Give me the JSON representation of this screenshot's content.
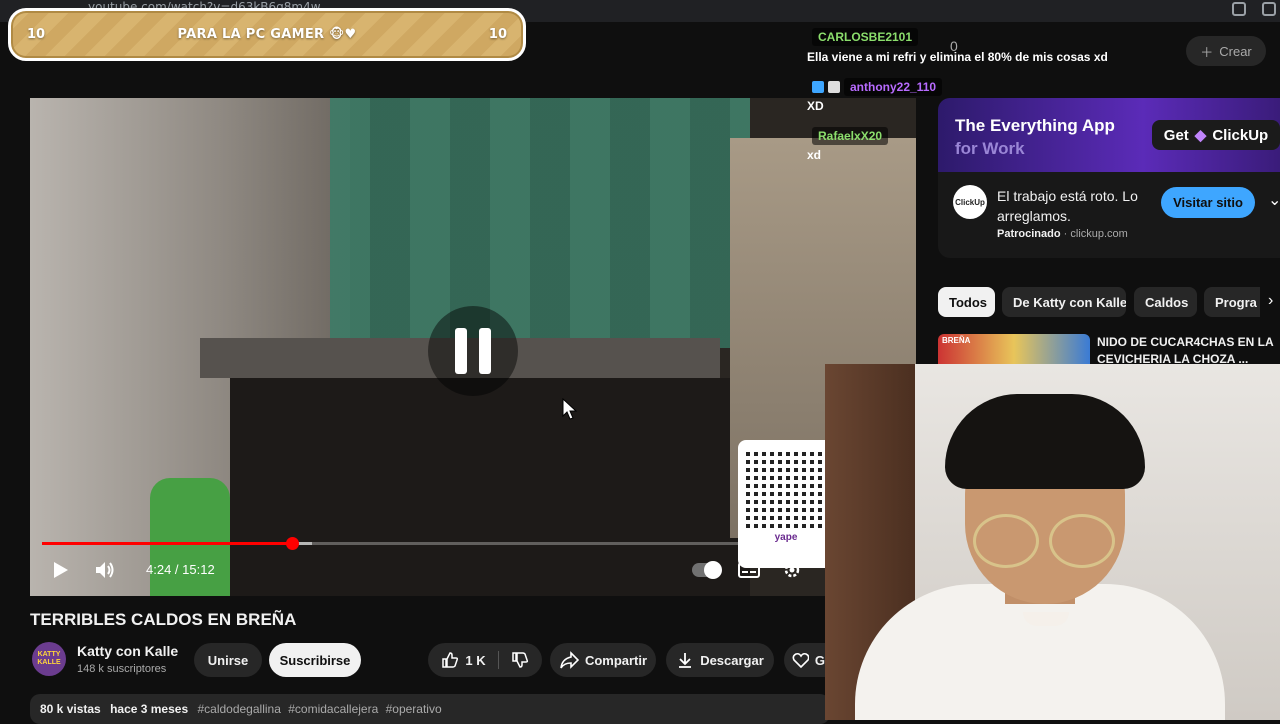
{
  "browser": {
    "url": "youtube.com/watch?v=d63kB6g8m4w"
  },
  "masthead": {
    "bell_count": "0",
    "create_label": "Crear"
  },
  "banner": {
    "left": "10",
    "text": "PARA LA PC GAMER 🐵♥",
    "right": "10"
  },
  "chat": [
    {
      "user": "CARLOSBE2101",
      "user_color": "#8bde6c",
      "message": "Ella viene a mi refri y elimina el 80% de mis cosas xd"
    },
    {
      "user": "anthony22_110",
      "user_color": "#b86bff",
      "message": "XD"
    },
    {
      "user": "RafaelxX20",
      "user_color": "#8bde6c",
      "message": "xd"
    }
  ],
  "player": {
    "time": "4:24 / 15:12",
    "progress": 0.29,
    "qr_label": "yape"
  },
  "video": {
    "title": "TERRIBLES CALDOS EN BREÑA",
    "channel": "Katty con Kalle",
    "avatar_text": "KATTY KALLE",
    "subscribers": "148 k suscriptores",
    "join_label": "Unirse",
    "subscribe_label": "Suscribirse",
    "likes": "1 K",
    "share_label": "Compartir",
    "download_label": "Descargar",
    "thanks_label": "G",
    "views": "80 k vistas",
    "age": "hace 3 meses",
    "hashtags": [
      "#caldodegallina",
      "#comidacallejera",
      "#operativo"
    ]
  },
  "ad": {
    "headline": "The Everything App",
    "subline": "for Work",
    "get_label": "Get",
    "brand": "ClickUp",
    "logo_text": "ClickUp",
    "text": "El trabajo está roto. Lo arreglamos.",
    "sponsored": "Patrocinado",
    "domain": "clickup.com",
    "cta": "Visitar sitio"
  },
  "chips": [
    "Todos",
    "De Katty con Kalle",
    "Caldos",
    "Progra"
  ],
  "recommendation": {
    "thumb_label": "BREÑA",
    "title": "NIDO DE CUCAR4CHAS EN LA CEVICHERIA LA CHOZA ..."
  },
  "colors": {
    "accent": "#ff0000",
    "link": "#3ea6ff",
    "background": "#0f0f0f"
  }
}
